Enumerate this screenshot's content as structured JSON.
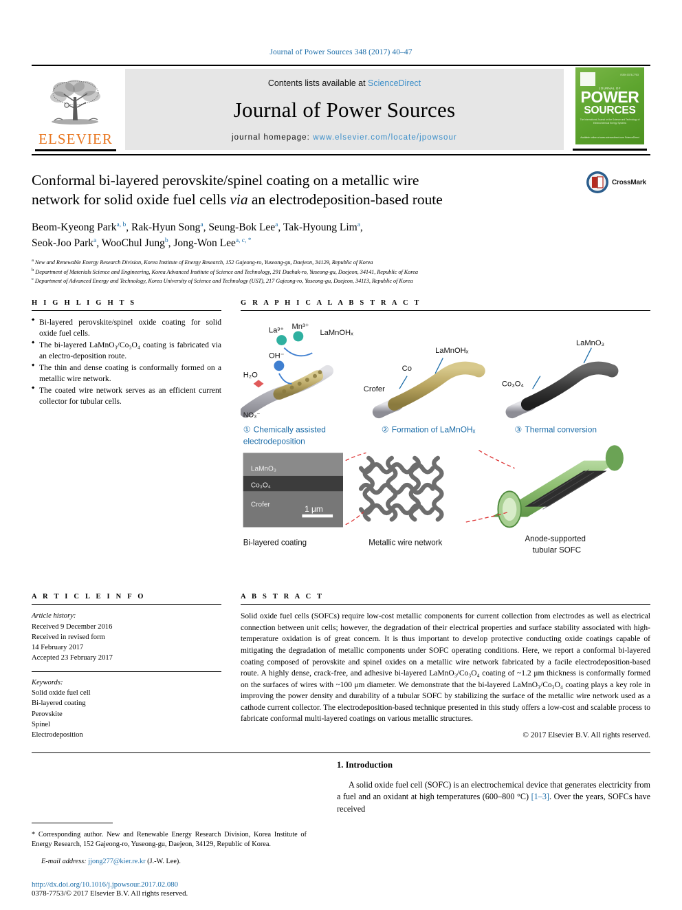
{
  "running_head": "Journal of Power Sources 348 (2017) 40–47",
  "masthead": {
    "contents_prefix": "Contents lists available at ",
    "sciencedirect": "ScienceDirect",
    "journal_title": "Journal of Power Sources",
    "homepage_prefix": "journal homepage: ",
    "homepage_url": "www.elsevier.com/locate/jpowsour",
    "publisher_wordmark": "ELSEVIER",
    "cover": {
      "kicker": "JOURNAL OF",
      "word1": "POWER",
      "word2": "SOURCES",
      "subtitle": "The International Journal on the Science and Technology of Electrochemical Energy Systems",
      "footer": "Available online at www.sciencedirect.com\nScienceDirect",
      "corner": "ISSN 0378-7753"
    }
  },
  "article": {
    "title_line1": "Conformal bi-layered perovskite/spinel coating on a metallic wire",
    "title_line2_a": "network for solid oxide fuel cells ",
    "title_line2_italic": "via",
    "title_line2_b": " an electrodeposition-based route",
    "crossmark_label": "CrossMark",
    "authors": [
      {
        "name": "Beom-Kyeong Park",
        "marks": "a, b",
        "sep": ", "
      },
      {
        "name": "Rak-Hyun Song",
        "marks": "a",
        "sep": ", "
      },
      {
        "name": "Seung-Bok Lee",
        "marks": "a",
        "sep": ", "
      },
      {
        "name": "Tak-Hyoung Lim",
        "marks": "a",
        "sep": ", "
      },
      {
        "name": "Seok-Joo Park",
        "marks": "a",
        "sep": ", "
      },
      {
        "name": "WooChul Jung",
        "marks": "b",
        "sep": ", "
      },
      {
        "name": "Jong-Won Lee",
        "marks": "a, c, *",
        "sep": ""
      }
    ],
    "affiliations": [
      {
        "mark": "a",
        "text": "New and Renewable Energy Research Division, Korea Institute of Energy Research, 152 Gajeong-ro, Yuseong-gu, Daejeon, 34129, Republic of Korea"
      },
      {
        "mark": "b",
        "text": "Department of Materials Science and Engineering, Korea Advanced Institute of Science and Technology, 291 Daehak-ro, Yuseong-gu, Daejeon, 34141, Republic of Korea"
      },
      {
        "mark": "c",
        "text": "Department of Advanced Energy and Technology, Korea University of Science and Technology (UST), 217 Gajeong-ro, Yuseong-gu, Daejeon, 34113, Republic of Korea"
      }
    ]
  },
  "highlights": {
    "heading": "H I G H L I G H T S",
    "items": [
      "Bi-layered perovskite/spinel oxide coating for solid oxide fuel cells.",
      "The bi-layered LaMnO₃/Co₃O₄ coating is fabricated via an electro-deposition route.",
      "The thin and dense coating is conformally formed on a metallic wire network.",
      "The coated wire network serves as an efficient current collector for tubular cells."
    ]
  },
  "graphical_abstract": {
    "heading": "G R A P H I C A L   A B S T R A C T",
    "panels": [
      {
        "number": "①",
        "caption_line1": "Chemically assisted",
        "caption_line2": "electrodeposition"
      },
      {
        "number": "②",
        "caption_line1": "Formation of LaMnOHₓ",
        "caption_line2": ""
      },
      {
        "number": "③",
        "caption_line1": "Thermal conversion",
        "caption_line2": ""
      }
    ],
    "species": [
      "La³⁺",
      "Mn³⁺",
      "LaMnOHₓ",
      "OH⁻",
      "H₂O",
      "NO₃⁻"
    ],
    "wire_labels_panel2": [
      "Crofer",
      "Co",
      "LaMnOHₓ"
    ],
    "wire_labels_panel3": [
      "Co₃O₄",
      "LaMnO₃"
    ],
    "sem_layers": [
      "LaMnO₃",
      "Co₃O₄",
      "Crofer"
    ],
    "scale_bar": "1 μm",
    "bottom_captions": [
      "Bi-layered coating",
      "Metallic wire network",
      "Anode-supported\ntubular SOFC"
    ],
    "caption_sofc_line1": "Anode-supported",
    "caption_sofc_line2": "tubular SOFC"
  },
  "article_info": {
    "heading": "A R T I C L E   I N F O",
    "history_label": "Article history:",
    "history": [
      "Received 9 December 2016",
      "Received in revised form",
      "14 February 2017",
      "Accepted 23 February 2017"
    ],
    "keywords_label": "Keywords:",
    "keywords": [
      "Solid oxide fuel cell",
      "Bi-layered coating",
      "Perovskite",
      "Spinel",
      "Electrodeposition"
    ]
  },
  "abstract": {
    "heading": "A B S T R A C T",
    "text": "Solid oxide fuel cells (SOFCs) require low-cost metallic components for current collection from electrodes as well as electrical connection between unit cells; however, the degradation of their electrical properties and surface stability associated with high-temperature oxidation is of great concern. It is thus important to develop protective conducting oxide coatings capable of mitigating the degradation of metallic components under SOFC operating conditions. Here, we report a conformal bi-layered coating composed of perovskite and spinel oxides on a metallic wire network fabricated by a facile electrodeposition-based route. A highly dense, crack-free, and adhesive bi-layered LaMnO₃/Co₃O₄ coating of ~1.2 μm thickness is conformally formed on the surfaces of wires with ~100 μm diameter. We demonstrate that the bi-layered LaMnO₃/Co₃O₄ coating plays a key role in improving the power density and durability of a tubular SOFC by stabilizing the surface of the metallic wire network used as a cathode current collector. The electrodeposition-based technique presented in this study offers a low-cost and scalable process to fabricate conformal multi-layered coatings on various metallic structures.",
    "copyright": "© 2017 Elsevier B.V. All rights reserved."
  },
  "footer": {
    "corresponding_mark": "*",
    "corresponding_text": " Corresponding author. New and Renewable Energy Research Division, Korea Institute of Energy Research, 152 Gajeong-ro, Yuseong-gu, Daejeon, 34129, Republic of Korea.",
    "email_label": "E-mail address:",
    "email": "jjong277@kier.re.kr",
    "email_suffix": " (J.-W. Lee).",
    "doi": "http://dx.doi.org/10.1016/j.jpowsour.2017.02.080",
    "issn": "0378-7753/© 2017 Elsevier B.V. All rights reserved."
  },
  "introduction": {
    "heading": "1. Introduction",
    "paragraph_a": "A solid oxide fuel cell (SOFC) is an electrochemical device that generates electricity from a fuel and an oxidant at high temperatures (600–800 °C) ",
    "citation": "[1–3]",
    "paragraph_b": ". Over the years, SOFCs have received"
  },
  "colors": {
    "link_blue": "#1b6ca8",
    "sciencedirect_blue": "#3d8fc9",
    "elsevier_orange": "#e87722",
    "cover_green": "#5ea52f"
  }
}
